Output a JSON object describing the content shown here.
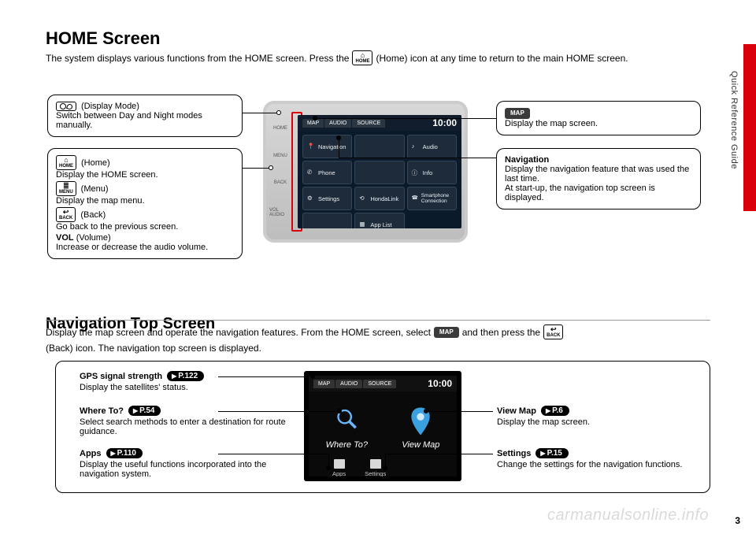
{
  "sideTab": "Quick Reference Guide",
  "pageNumber": "3",
  "watermark": "carmanualsonline.info",
  "section1": {
    "title": "HOME Screen",
    "introA": "The system displays various functions from the HOME screen. Press the",
    "introB": "(Home) icon at any time to return to the main HOME screen.",
    "homeIcon": {
      "glyph": "⌂",
      "label": "HOME"
    },
    "callouts": {
      "displayMode": {
        "label": "(Display Mode)",
        "desc": "Switch between Day and Night modes manually."
      },
      "leftStack": {
        "homeLabel": "(Home)",
        "homeDesc": "Display the HOME screen.",
        "menuLabel": "(Menu)",
        "menuDesc": "Display the map menu.",
        "backLabel": "(Back)",
        "backDesc": "Go back to the previous screen.",
        "volLabel": "VOL",
        "volParen": "(Volume)",
        "volDesc": "Increase or decrease the audio volume."
      },
      "map": {
        "btn": "MAP",
        "desc": "Display the map screen."
      },
      "navigation": {
        "title": "Navigation",
        "desc": "Display the navigation feature that was used the last time.\nAt start-up, the navigation top screen is displayed."
      }
    },
    "device": {
      "tabs": [
        "MAP",
        "AUDIO",
        "SOURCE"
      ],
      "clock": "10:00",
      "tiles": [
        "Navigation",
        "Audio",
        "Phone",
        "Info",
        "Settings",
        "HondaLink",
        "Smartphone Connection",
        "App List"
      ],
      "stripLabels": [
        "HOME",
        "MENU",
        "BACK",
        "VOL AUDIO"
      ]
    }
  },
  "section2": {
    "title": "Navigation Top Screen",
    "introA": "Display the map screen and operate the navigation features. From the HOME screen, select",
    "introB": "and then press the",
    "introC": "(Back) icon. The navigation top screen is displayed.",
    "mapBtn": "MAP",
    "backBtn": "BACK",
    "device": {
      "tabs": [
        "MAP",
        "AUDIO",
        "SOURCE"
      ],
      "clock": "10:00",
      "big": [
        "Where To?",
        "View Map"
      ],
      "small": [
        "Apps",
        "Settings"
      ]
    },
    "items": {
      "gps": {
        "title": "GPS signal strength",
        "ref": "P.122",
        "desc": "Display the satellites' status."
      },
      "where": {
        "title": "Where To?",
        "ref": "P.54",
        "desc": "Select search methods to enter a destination for route guidance."
      },
      "apps": {
        "title": "Apps",
        "ref": "P.110",
        "desc": "Display the useful functions incorporated into the navigation system."
      },
      "view": {
        "title": "View Map",
        "ref": "P.6",
        "desc": "Display the map screen."
      },
      "settings": {
        "title": "Settings",
        "ref": "P.15",
        "desc": "Change the settings for the navigation functions."
      }
    }
  }
}
